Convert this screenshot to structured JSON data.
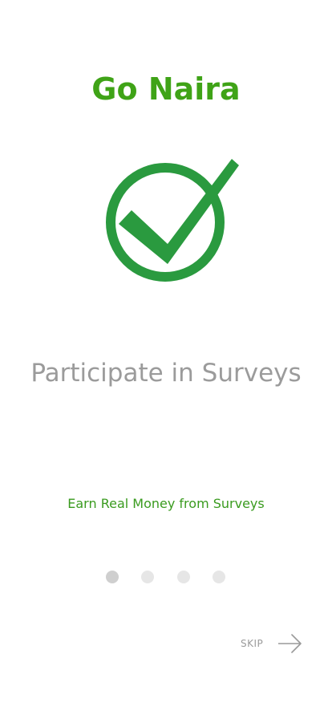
{
  "app": {
    "title": "Go Naira"
  },
  "onboarding": {
    "headline": "Participate in Surveys",
    "subtitle": "Earn Real Money from Surveys",
    "page_indicator": {
      "current": 1,
      "total": 4
    },
    "skip_label": "SKIP",
    "hero_icon": "check-circle-icon",
    "next_icon": "arrow-right-icon"
  },
  "colors": {
    "brand_green": "#3fa317",
    "icon_green": "#2a9a3f",
    "headline_gray": "#9b9b9b",
    "subtitle_green": "#3a9b1f",
    "dot_active": "#cfcfcf",
    "dot_inactive": "#e6e6e6",
    "skip_gray": "#9a9a9a"
  }
}
